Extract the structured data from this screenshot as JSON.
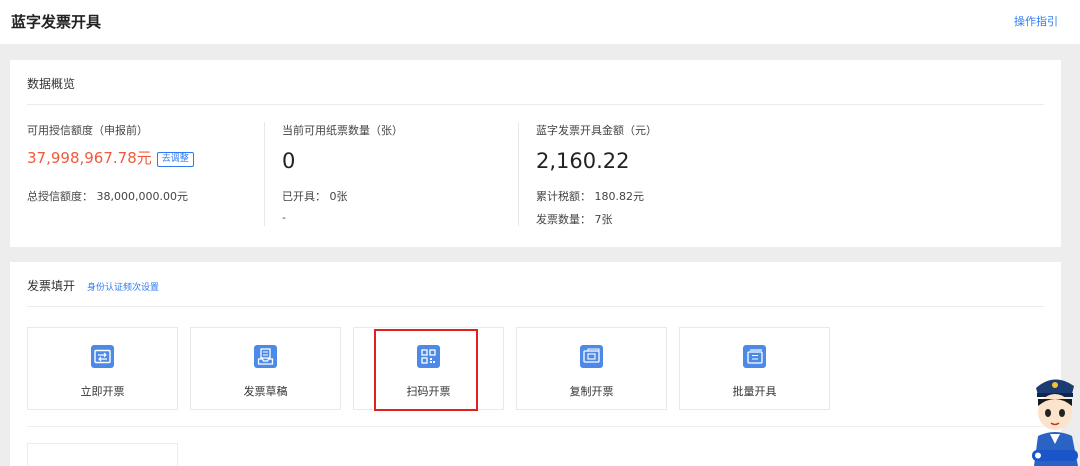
{
  "header": {
    "title": "蓝字发票开具",
    "guide_link": "操作指引"
  },
  "overview": {
    "title": "数据概览",
    "credit": {
      "label": "可用授信额度（申报前）",
      "value": "37,998,967.78元",
      "adjust_button": "去调整",
      "total_label": "总授信额度：",
      "total_value": "38,000,000.00元"
    },
    "paper": {
      "label": "当前可用纸票数量（张）",
      "value": "0",
      "issued_label": "已开具：",
      "issued_value": "0张",
      "extra": "-"
    },
    "blue_invoice": {
      "label": "蓝字发票开具金额（元）",
      "value": "2,160.22",
      "tax_label": "累计税额：",
      "tax_value": "180.82元",
      "count_label": "发票数量：",
      "count_value": "7张"
    }
  },
  "invoice_section": {
    "title": "发票填开",
    "auth_link": "身份认证频次设置",
    "tiles": [
      {
        "label": "立即开票",
        "icon": "invoice-arrows-icon"
      },
      {
        "label": "发票草稿",
        "icon": "draft-tray-icon"
      },
      {
        "label": "扫码开票",
        "icon": "qr-code-icon"
      },
      {
        "label": "复制开票",
        "icon": "copy-ticket-icon"
      },
      {
        "label": "批量开具",
        "icon": "batch-ticket-icon"
      }
    ]
  },
  "colors": {
    "accent": "#2f7bf5",
    "icon_bg": "#4d89e6",
    "amount_red": "#f05a3c",
    "highlight": "#e0201f"
  }
}
